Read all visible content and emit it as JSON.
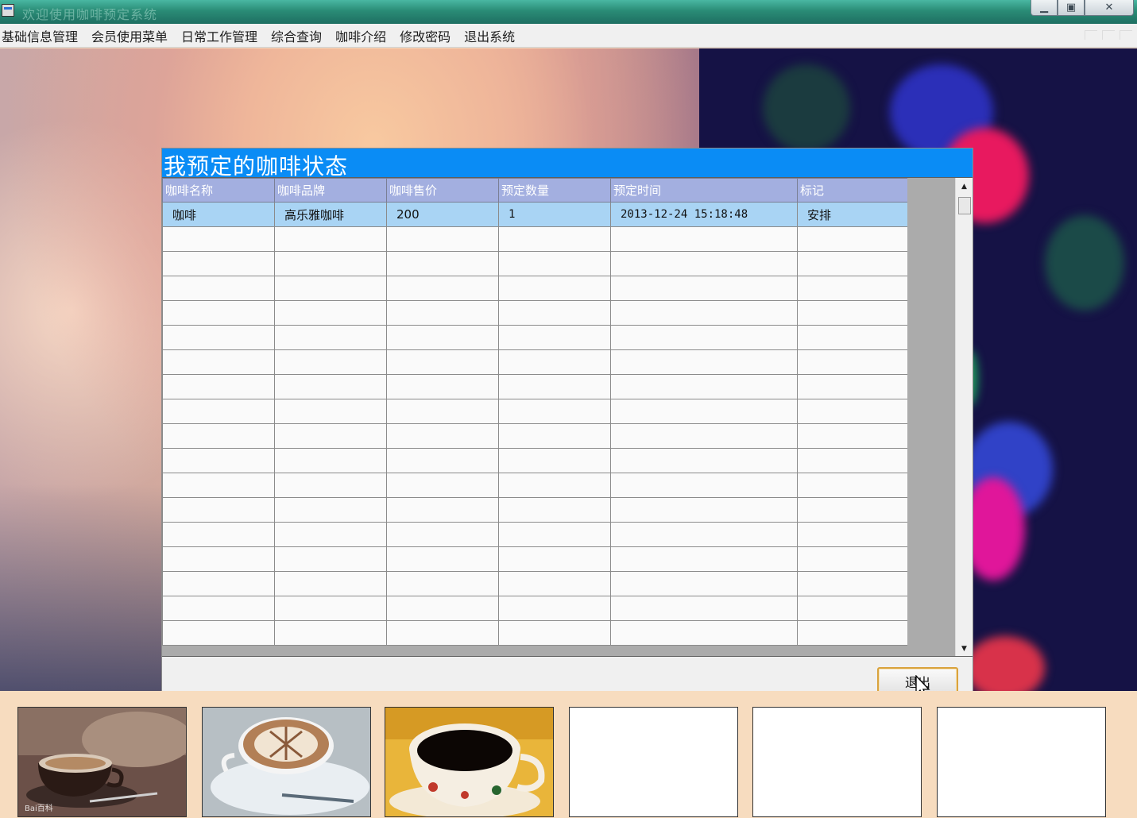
{
  "window": {
    "title": "欢迎使用咖啡预定系统",
    "icons": [
      "app-icon",
      "minimize-icon",
      "maximize-icon",
      "close-icon"
    ]
  },
  "menu": {
    "items": [
      "基础信息管理",
      "会员使用菜单",
      "日常工作管理",
      "综合查询",
      "咖啡介绍",
      "修改密码",
      "退出系统"
    ]
  },
  "dialog": {
    "title": "我预定的咖啡状态",
    "header_color": "#0a8cf5",
    "exit_label": "退出"
  },
  "grid": {
    "columns": [
      "咖啡名称",
      "咖啡品牌",
      "咖啡售价",
      "预定数量",
      "预定时间",
      "标记"
    ],
    "rows": [
      [
        "咖啡",
        "高乐雅咖啡",
        "200",
        "1",
        "2013-12-24  15:18:48",
        "安排"
      ]
    ],
    "empty_rows": 17,
    "header_color": "#a3afe0",
    "selected_color": "#a9d4f4"
  },
  "thumbnails": [
    {
      "name": "coffee-cup-photo",
      "caption": "Bai百科"
    },
    {
      "name": "latte-art-photo"
    },
    {
      "name": "black-coffee-photo"
    },
    {
      "name": "empty-thumbnail"
    },
    {
      "name": "empty-thumbnail"
    },
    {
      "name": "empty-thumbnail"
    }
  ]
}
